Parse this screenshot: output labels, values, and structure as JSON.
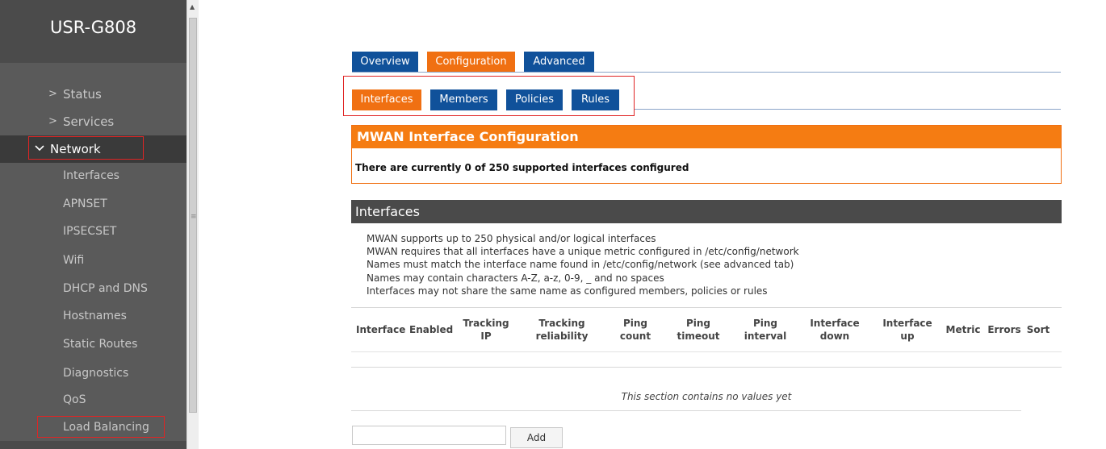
{
  "brand": {
    "title": "USR-G808"
  },
  "sidebar": {
    "items": [
      {
        "label": "Status"
      },
      {
        "label": "Services"
      },
      {
        "label": "Network"
      }
    ],
    "subitems": [
      {
        "label": "Interfaces"
      },
      {
        "label": "APNSET"
      },
      {
        "label": "IPSECSET"
      },
      {
        "label": "Wifi"
      },
      {
        "label": "DHCP and DNS"
      },
      {
        "label": "Hostnames"
      },
      {
        "label": "Static Routes"
      },
      {
        "label": "Diagnostics"
      },
      {
        "label": "QoS"
      },
      {
        "label": "Load Balancing"
      }
    ]
  },
  "tabs": {
    "main": [
      {
        "label": "Overview"
      },
      {
        "label": "Configuration"
      },
      {
        "label": "Advanced"
      }
    ],
    "sub": [
      {
        "label": "Interfaces"
      },
      {
        "label": "Members"
      },
      {
        "label": "Policies"
      },
      {
        "label": "Rules"
      }
    ]
  },
  "mwan": {
    "title": "MWAN Interface Configuration",
    "message": "There are currently 0 of 250 supported interfaces configured"
  },
  "interfaces": {
    "title": "Interfaces",
    "description": [
      "MWAN supports up to 250 physical and/or logical interfaces",
      "MWAN requires that all interfaces have a unique metric configured in /etc/config/network",
      "Names must match the interface name found in /etc/config/network (see advanced tab)",
      "Names may contain characters A-Z, a-z, 0-9, _ and no spaces",
      "Interfaces may not share the same name as configured members, policies or rules"
    ],
    "columns": [
      {
        "l1": "Interface",
        "l2": ""
      },
      {
        "l1": "Enabled",
        "l2": ""
      },
      {
        "l1": "Tracking",
        "l2": "IP"
      },
      {
        "l1": "Tracking",
        "l2": "reliability"
      },
      {
        "l1": "Ping",
        "l2": "count"
      },
      {
        "l1": "Ping",
        "l2": "timeout"
      },
      {
        "l1": "Ping",
        "l2": "interval"
      },
      {
        "l1": "Interface",
        "l2": "down"
      },
      {
        "l1": "Interface",
        "l2": "up"
      },
      {
        "l1": "Metric",
        "l2": ""
      },
      {
        "l1": "Errors",
        "l2": ""
      },
      {
        "l1": "Sort",
        "l2": ""
      }
    ],
    "empty_message": "This section contains no values yet",
    "add_input_value": "",
    "add_button": "Add"
  },
  "colors": {
    "accent_orange": "#f07012",
    "tab_blue": "#10519a",
    "sidebar_bg": "#5a5a5a",
    "highlight_red": "#e02424"
  }
}
